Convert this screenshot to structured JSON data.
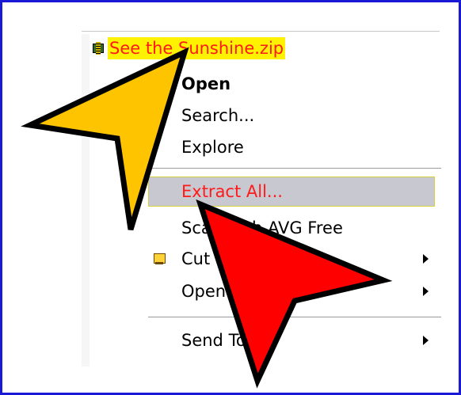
{
  "file": {
    "name": "See the Sunshine.zip",
    "icon": "zip-folder-icon"
  },
  "context_menu": {
    "items": [
      {
        "label": "Open",
        "bold": true
      },
      {
        "label": "Search..."
      },
      {
        "label": "Explore"
      },
      {
        "label": "Extract All...",
        "highlighted": true
      },
      {
        "label": "Scan with AVG Free"
      },
      {
        "label": "Cut",
        "icon": "winzip-icon",
        "has_submenu": true
      },
      {
        "label": "Open With",
        "has_submenu": true
      },
      {
        "label": "Send To",
        "has_submenu": true
      }
    ]
  },
  "overlay": {
    "pointer_colors": {
      "yellow": "#ffc400",
      "red": "#ff0000"
    }
  }
}
